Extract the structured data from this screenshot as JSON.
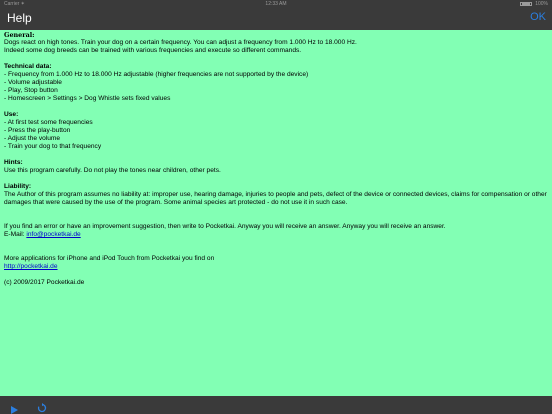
{
  "status_bar": {
    "carrier": "Carrier ✶",
    "time": "12:33 AM",
    "battery": "100%"
  },
  "nav": {
    "title": "Help",
    "ok_label": "OK"
  },
  "content": {
    "general_heading": "General:",
    "general_lines": [
      "Dogs react on high tones. Train your dog on a certain frequency. You can adjust a frequency from 1.000 Hz to 18.000 Hz.",
      "Indeed some dog breeds can be trained with various frequencies and execute so different commands."
    ],
    "technical_heading": "Technical data:",
    "technical_lines": [
      "- Frequency from 1.000 Hz to 18.000 Hz adjustable (higher frequencies are not supported by the device)",
      "- Volume adjustable",
      "- Play, Stop button",
      "- Homescreen > Settings > Dog Whistle sets fixed values"
    ],
    "use_heading": "Use:",
    "use_lines": [
      "- At first test some frequencies",
      "- Press the play-button",
      "- Adjust the volume",
      "- Train your dog to that frequency"
    ],
    "hints_heading": "Hints:",
    "hints_line": "Use this program carefully. Do not play the tones near children, other pets.",
    "liability_heading": "Liability:",
    "liability_text": "The Author of this program assumes no liability at: improper use, hearing damage,  injuries to people and pets, defect of the device or connected devices, claims for compensation or other damages that were caused by the use of the program. Some animal species art protected - do not use it in such case.",
    "feedback_line": "If you find an error or have an improvement suggestion, then write to Pocketkai. Anyway you will receive an answer. Anyway you will receive an answer.",
    "email_label": "E-Mail: ",
    "email_link": "info@pocketkai.de",
    "more_apps_line": "More applications for iPhone and iPod Touch from Pocketkai you find on",
    "website_link": "http://pocketkai.de",
    "copyright": "(c) 2009/2017 Pocketkai.de"
  },
  "toolbar": {
    "play_icon": "play-icon",
    "replay_icon": "replay-icon",
    "accent_color": "#2b7fe0"
  },
  "colors": {
    "background": "#82FFB4",
    "bars": "#3a3a3a",
    "accent": "#2b7fe0",
    "link": "#0000cc"
  }
}
